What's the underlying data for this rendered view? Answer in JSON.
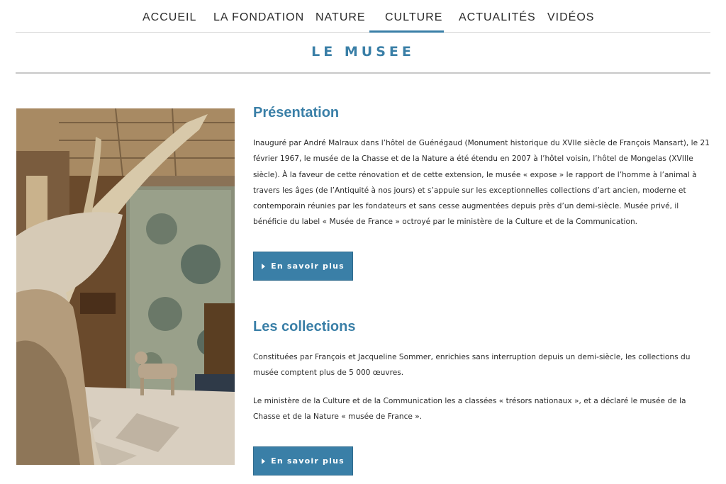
{
  "nav": {
    "items": [
      {
        "label": "ACCUEIL"
      },
      {
        "label": "LA FONDATION"
      },
      {
        "label": "NATURE"
      },
      {
        "label": "CULTURE"
      },
      {
        "label": "ACTUALITÉS"
      },
      {
        "label": "VIDÉOS"
      }
    ],
    "active": "CULTURE"
  },
  "page": {
    "title": "LE MUSEE"
  },
  "presentation": {
    "heading": "Présentation",
    "body": "Inauguré par André Malraux dans l’hôtel de Guénégaud (Monument historique du XVIIe siècle de François Mansart), le 21 février 1967, le musée de la Chasse et de la Nature a été étendu en 2007 à l’hôtel voisin, l’hôtel de Mongelas (XVIIIe siècle). À la faveur de cette rénovation et de cette extension, le musée « expose » le rapport de l’homme à l’animal à travers les âges (de l’Antiquité à nos jours) et s’appuie sur les exceptionnelles collections d’art ancien, moderne et contemporain réunies par les fondateurs et sans cesse augmentées depuis près d’un demi-siècle. Musée privé, il bénéficie du label « Musée de France » octroyé par le ministère de la Culture et de la Communication.",
    "button_label": "En savoir plus"
  },
  "collections": {
    "heading": "Les collections",
    "body1": "Constituées par François et Jacqueline Sommer, enrichies sans interruption depuis un demi-siècle, les collections du musée comptent plus de 5 000 œuvres.",
    "body2": "Le ministère de la Culture et de la Communication les a classées « trésors nationaux », et a déclaré le musée de la Chasse et de la Nature « musée de France ».",
    "button_label": "En savoir plus"
  },
  "colors": {
    "accent": "#3a7fa7",
    "text": "#2a2a2a",
    "rule": "#c8c8c8"
  },
  "icons": {
    "button_icon": "triangle-right-icon"
  }
}
